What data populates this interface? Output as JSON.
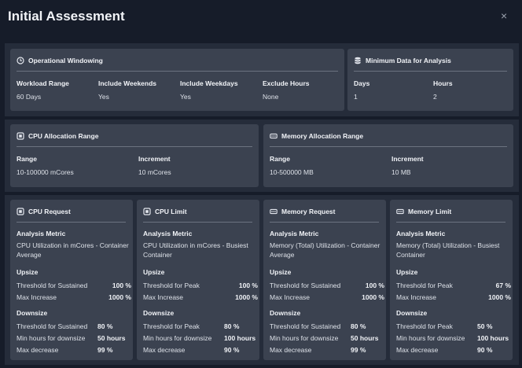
{
  "title": "Initial Assessment",
  "close_icon": "×",
  "operational": {
    "title": "Operational Windowing",
    "headers": [
      "Workload Range",
      "Include Weekends",
      "Include Weekdays",
      "Exclude Hours"
    ],
    "values": [
      "60 Days",
      "Yes",
      "Yes",
      "None"
    ]
  },
  "min_data": {
    "title": "Minimum Data for Analysis",
    "headers": [
      "Days",
      "Hours"
    ],
    "values": [
      "1",
      "2"
    ]
  },
  "cpu_alloc": {
    "title": "CPU Allocation Range",
    "range_label": "Range",
    "range_value": "10-100000 mCores",
    "increment_label": "Increment",
    "increment_value": "10 mCores"
  },
  "mem_alloc": {
    "title": "Memory Allocation Range",
    "range_label": "Range",
    "range_value": "10-500000 MB",
    "increment_label": "Increment",
    "increment_value": "10 MB"
  },
  "cards": [
    {
      "title": "CPU Request",
      "metric_label": "Analysis Metric",
      "metric_value": "CPU Utilization in mCores - Container Average",
      "upsize_label": "Upsize",
      "upsize_rows": [
        {
          "label": "Threshold for Sustained",
          "value": "100 %"
        },
        {
          "label": "Max Increase",
          "value": "1000 %"
        }
      ],
      "downsize_label": "Downsize",
      "downsize_rows": [
        {
          "label": "Threshold for Sustained",
          "value": "80 %"
        },
        {
          "label": "Min hours for downsize",
          "value": "50 hours"
        },
        {
          "label": "Max decrease",
          "value": "99 %"
        }
      ]
    },
    {
      "title": "CPU Limit",
      "metric_label": "Analysis Metric",
      "metric_value": "CPU Utilization in mCores - Busiest Container",
      "upsize_label": "Upsize",
      "upsize_rows": [
        {
          "label": "Threshold for Peak",
          "value": "100 %"
        },
        {
          "label": "Max Increase",
          "value": "1000 %"
        }
      ],
      "downsize_label": "Downsize",
      "downsize_rows": [
        {
          "label": "Threshold for Peak",
          "value": "80 %"
        },
        {
          "label": "Min hours for downsize",
          "value": "100 hours"
        },
        {
          "label": "Max decrease",
          "value": "90 %"
        }
      ]
    },
    {
      "title": "Memory Request",
      "metric_label": "Analysis Metric",
      "metric_value": "Memory (Total) Utilization - Container Average",
      "upsize_label": "Upsize",
      "upsize_rows": [
        {
          "label": "Threshold for Sustained",
          "value": "100 %"
        },
        {
          "label": "Max Increase",
          "value": "1000 %"
        }
      ],
      "downsize_label": "Downsize",
      "downsize_rows": [
        {
          "label": "Threshold for Sustained",
          "value": "80 %"
        },
        {
          "label": "Min hours for downsize",
          "value": "50 hours"
        },
        {
          "label": "Max decrease",
          "value": "99 %"
        }
      ]
    },
    {
      "title": "Memory Limit",
      "metric_label": "Analysis Metric",
      "metric_value": "Memory (Total) Utilization - Busiest Container",
      "upsize_label": "Upsize",
      "upsize_rows": [
        {
          "label": "Threshold for Peak",
          "value": "67 %"
        },
        {
          "label": "Max Increase",
          "value": "1000 %"
        }
      ],
      "downsize_label": "Downsize",
      "downsize_rows": [
        {
          "label": "Threshold for Peak",
          "value": "50 %"
        },
        {
          "label": "Min hours for downsize",
          "value": "100 hours"
        },
        {
          "label": "Max decrease",
          "value": "90 %"
        }
      ]
    }
  ]
}
